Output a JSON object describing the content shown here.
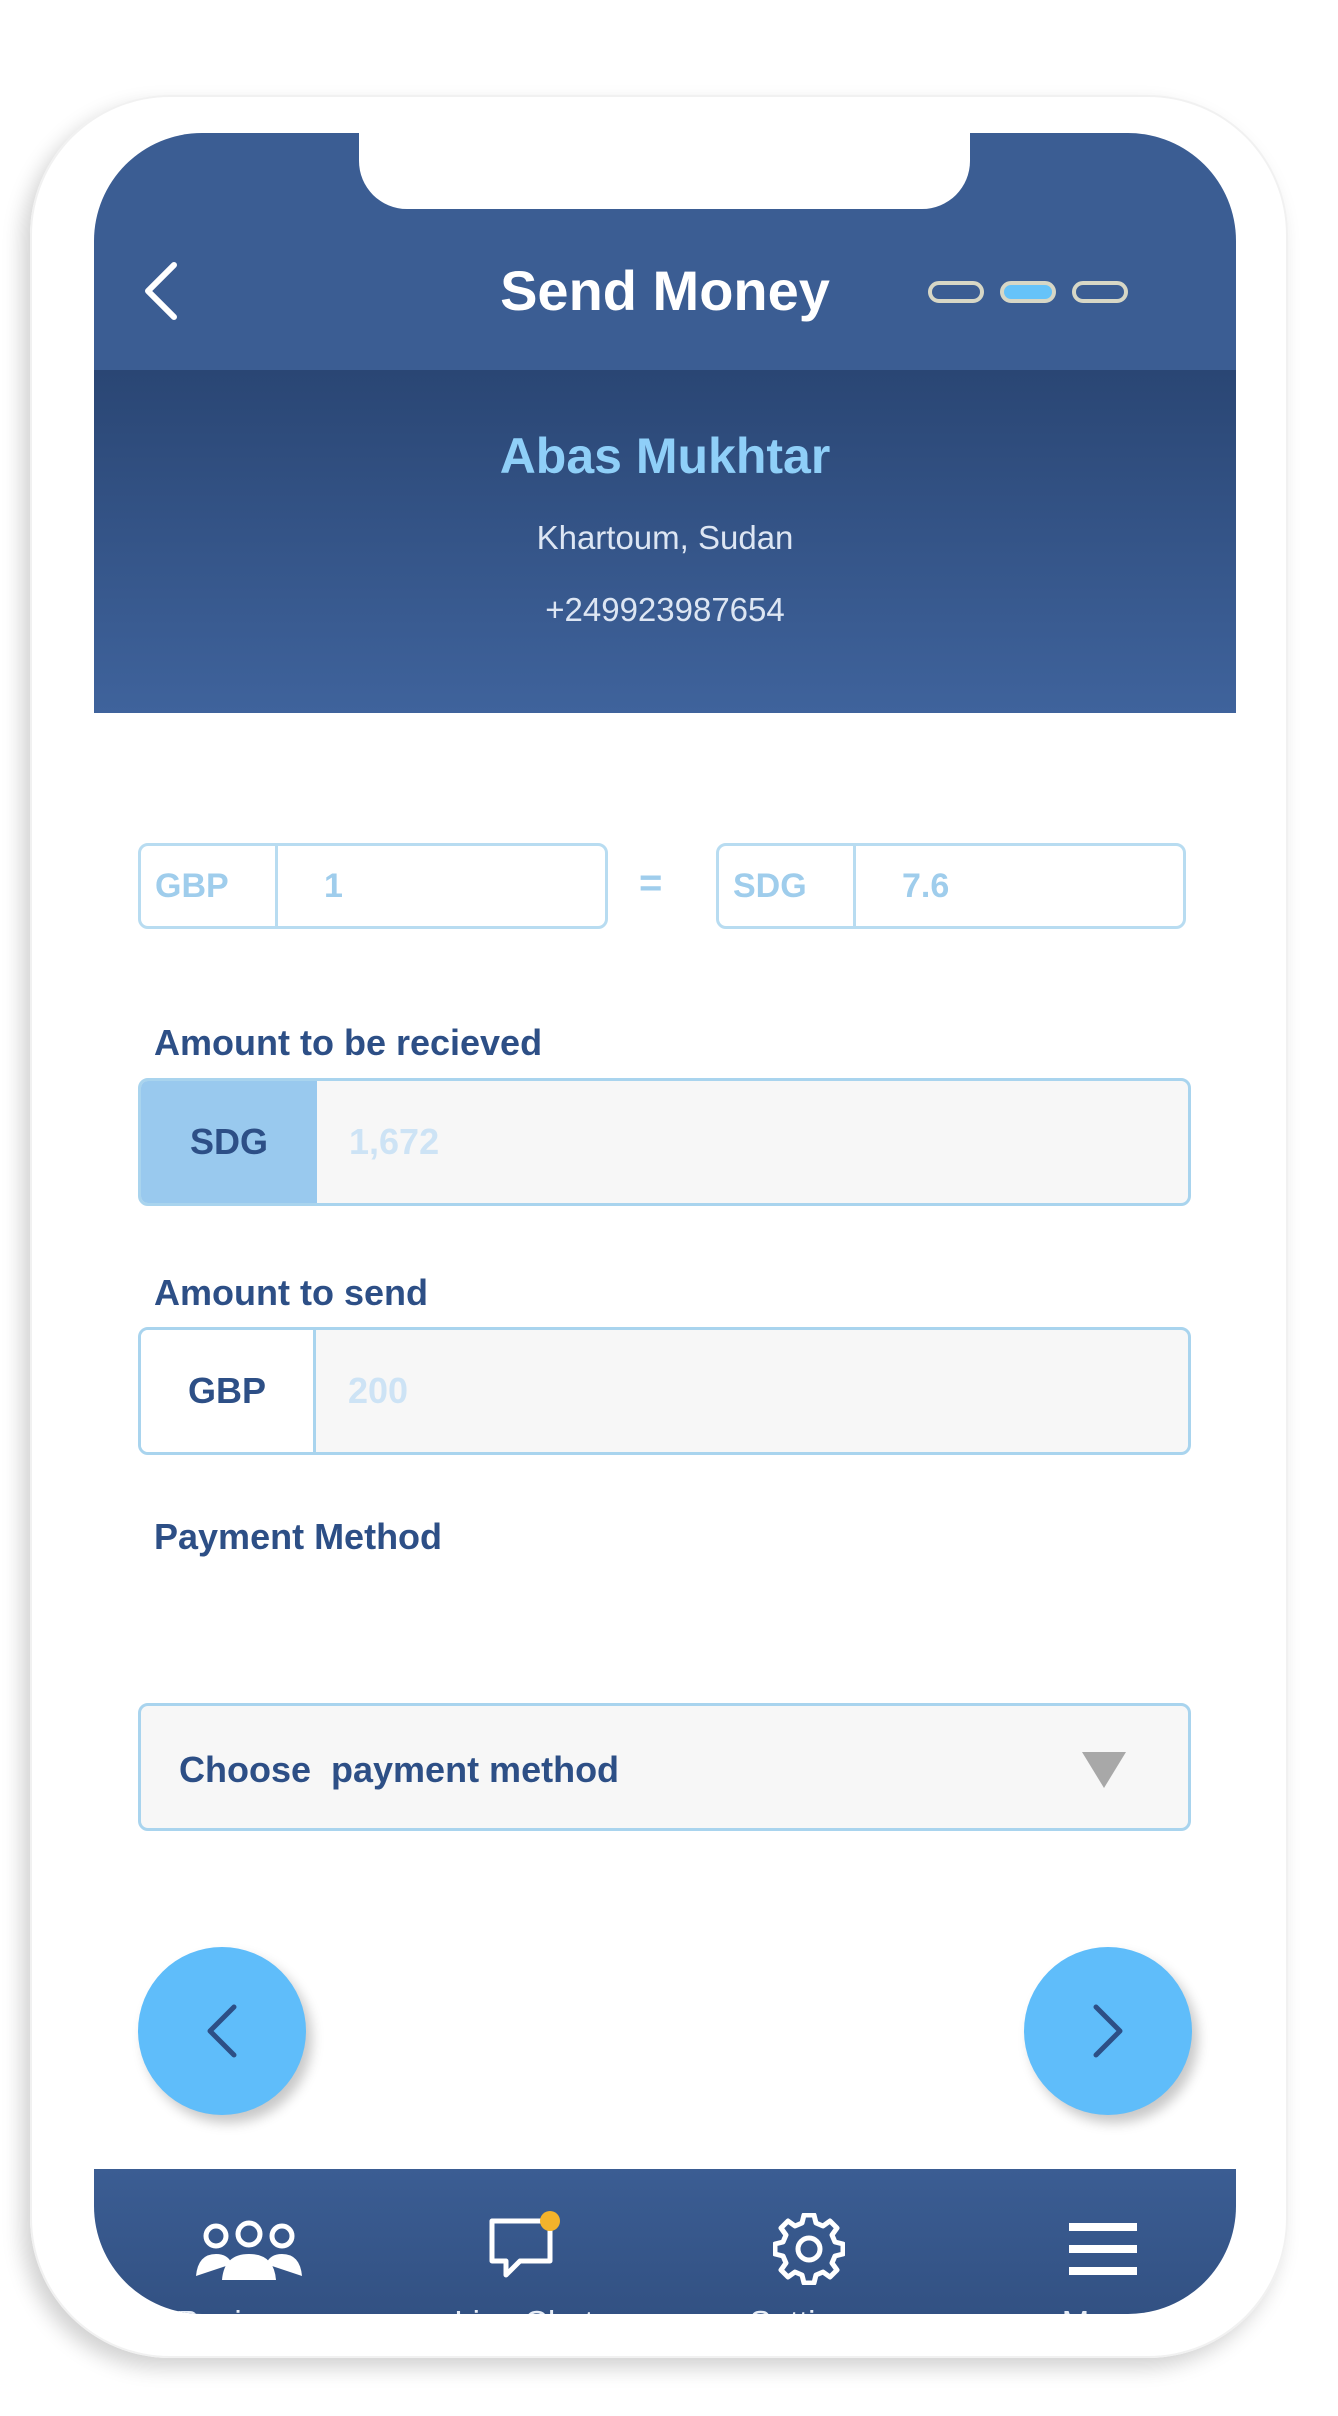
{
  "header": {
    "title": "Send Money",
    "steps": [
      {
        "state": "inactive"
      },
      {
        "state": "active"
      },
      {
        "state": "inactive"
      }
    ]
  },
  "receiver": {
    "name": "Abas Mukhtar",
    "location": "Khartoum, Sudan",
    "phone": "+249923987654"
  },
  "rate": {
    "from_currency": "GBP",
    "from_value": "1",
    "equals": "=",
    "to_currency": "SDG",
    "to_value": "7.6"
  },
  "receive": {
    "label": "Amount to be recieved",
    "currency": "SDG",
    "value": "1,672"
  },
  "send": {
    "label": "Amount to send",
    "currency": "GBP",
    "value": "200"
  },
  "payment": {
    "label": "Payment Method",
    "placeholder": "Choose  payment method"
  },
  "bottom_nav": {
    "items": [
      {
        "label": "Recievers",
        "icon": "receivers-icon"
      },
      {
        "label": "Live Chat",
        "icon": "chat-icon",
        "badge": true
      },
      {
        "label": "Settings",
        "icon": "gear-icon"
      },
      {
        "label": "Menu",
        "icon": "hamburger-icon"
      }
    ]
  },
  "colors": {
    "header": "#3b5d93",
    "accent": "#5fbdfa",
    "label": "#2d4f86",
    "badge": "#f4b32b"
  }
}
